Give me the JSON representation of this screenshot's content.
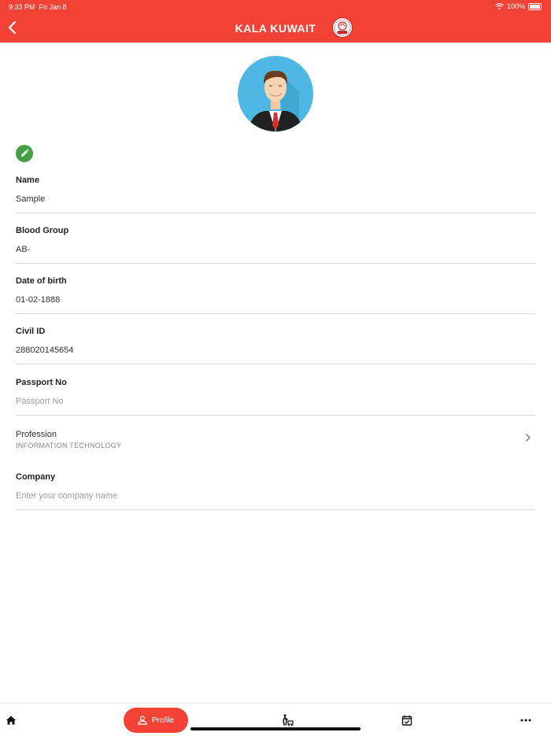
{
  "status_bar": {
    "time": "9:33 PM",
    "date": "Fri Jan 8",
    "battery": "100%"
  },
  "header": {
    "title": "KALA KUWAIT",
    "back_icon": "chevron-left-icon",
    "logo_icon": "kala-kuwait-logo-icon"
  },
  "fields": [
    {
      "label": "Name",
      "value": "Sample"
    },
    {
      "label": "Blood Group",
      "value": "AB-"
    },
    {
      "label": "Date of birth",
      "value": "01-02-1888"
    },
    {
      "label": "Civil ID",
      "value": "288020145654"
    },
    {
      "label": "Passport No",
      "placeholder": "Passport No"
    }
  ],
  "profession": {
    "label": "Profession",
    "value": "INFORMATION TECHNOLOGY"
  },
  "company": {
    "label": "Company",
    "placeholder": "Enter your company name"
  },
  "bottom_nav": {
    "active_label": "Profile"
  },
  "colors": {
    "accent": "#f44336",
    "edit": "#43a047",
    "divider": "#d6d6d6"
  }
}
